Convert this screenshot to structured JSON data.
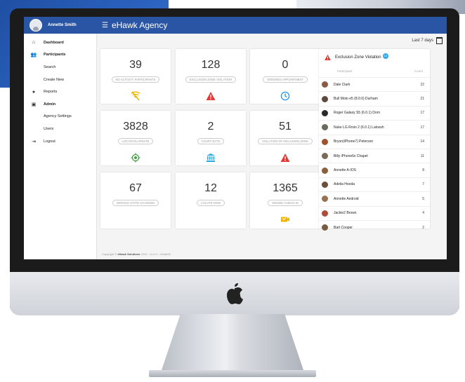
{
  "sidebar": {
    "user": "Annette Smith",
    "items": [
      {
        "label": "Dashboard",
        "icon": "home-icon",
        "glyph": "⌂",
        "bold": true
      },
      {
        "label": "Participants",
        "icon": "people-icon",
        "glyph": "👥",
        "bold": true
      },
      {
        "label": "Search",
        "icon": "",
        "glyph": "",
        "bold": false
      },
      {
        "label": "Create New",
        "icon": "",
        "glyph": "",
        "bold": false
      },
      {
        "label": "Reports",
        "icon": "info-icon",
        "glyph": "●",
        "bold": false
      },
      {
        "label": "Admin",
        "icon": "admin-icon",
        "glyph": "▣",
        "bold": true
      },
      {
        "label": "Agency Settings",
        "icon": "",
        "glyph": "",
        "bold": false
      },
      {
        "label": "Users",
        "icon": "",
        "glyph": "",
        "bold": false
      },
      {
        "label": "Logout",
        "icon": "logout-icon",
        "glyph": "⇥",
        "bold": false
      }
    ]
  },
  "header": {
    "menu_glyph": "☰",
    "title": "eHawk Agency"
  },
  "date_range": "Last 7 days",
  "cards": [
    {
      "value": "39",
      "label": "NO ACTIVITY PARTICIPANTS",
      "icon": "no-signal-icon",
      "color": "#f0b400"
    },
    {
      "value": "128",
      "label": "EXCLUSION ZONE VIOLATION",
      "icon": "warning-icon",
      "color": "#e53935"
    },
    {
      "value": "0",
      "label": "ORDERED APPOINTMENT",
      "icon": "clock-icon",
      "color": "#2196f3"
    },
    {
      "value": "3828",
      "label": "LOCATION UPDATE",
      "icon": "location-target-icon",
      "color": "#43a047"
    },
    {
      "value": "2",
      "label": "COURT DATE",
      "icon": "courthouse-icon",
      "color": "#29a8e0"
    },
    {
      "value": "51",
      "label": "VIOLATION OF INCLUSION ZONE",
      "icon": "warning-icon",
      "color": "#e53935"
    },
    {
      "value": "67",
      "label": "SERVICE STATE CHANGED",
      "icon": "",
      "color": ""
    },
    {
      "value": "12",
      "label": "LOCATE NOW",
      "icon": "",
      "color": ""
    },
    {
      "value": "1365",
      "label": "MISSED CHECK-IN",
      "icon": "missed-video-icon",
      "color": "#f0b400"
    }
  ],
  "panel": {
    "title": "Exclusion Zone Violation",
    "badge": "13",
    "col_participant": "Participant",
    "col_count": "Count",
    "rows": [
      {
        "name": "Dale Clark",
        "count": "22",
        "avatar": "#8a5a44"
      },
      {
        "name": "Bull Moto e5 (8.0.0) Durham",
        "count": "21",
        "avatar": "#5d4a3e"
      },
      {
        "name": "Roger Galaxy S5 (6.0.1) Dorn",
        "count": "17",
        "avatar": "#2a2a2a"
      },
      {
        "name": "Nuke LG Rrsio 2 (6.0.1) Laloosh",
        "count": "17",
        "avatar": "#6a6a5a"
      },
      {
        "name": "Bryon(iPhone7) Peterson",
        "count": "14",
        "avatar": "#a0522d"
      },
      {
        "name": "Billy iPhone6s Chapel",
        "count": "11",
        "avatar": "#7a6a5a"
      },
      {
        "name": "Annette A-IOS",
        "count": "8",
        "avatar": "#8b5e3c"
      },
      {
        "name": "Adelia Hooda",
        "count": "7",
        "avatar": "#6b4f3a"
      },
      {
        "name": "Annette Android",
        "count": "5",
        "avatar": "#9a7050"
      },
      {
        "name": "Jackie2 Brown",
        "count": "4",
        "avatar": "#b04a3a"
      },
      {
        "name": "Bart Cooper",
        "count": "2",
        "avatar": "#7b5a40"
      }
    ]
  },
  "footer": {
    "prefix": "Copyright ©",
    "company": "eHawk Solutions",
    "suffix": "2019 · v1.0.0 - 2c0ab28"
  }
}
